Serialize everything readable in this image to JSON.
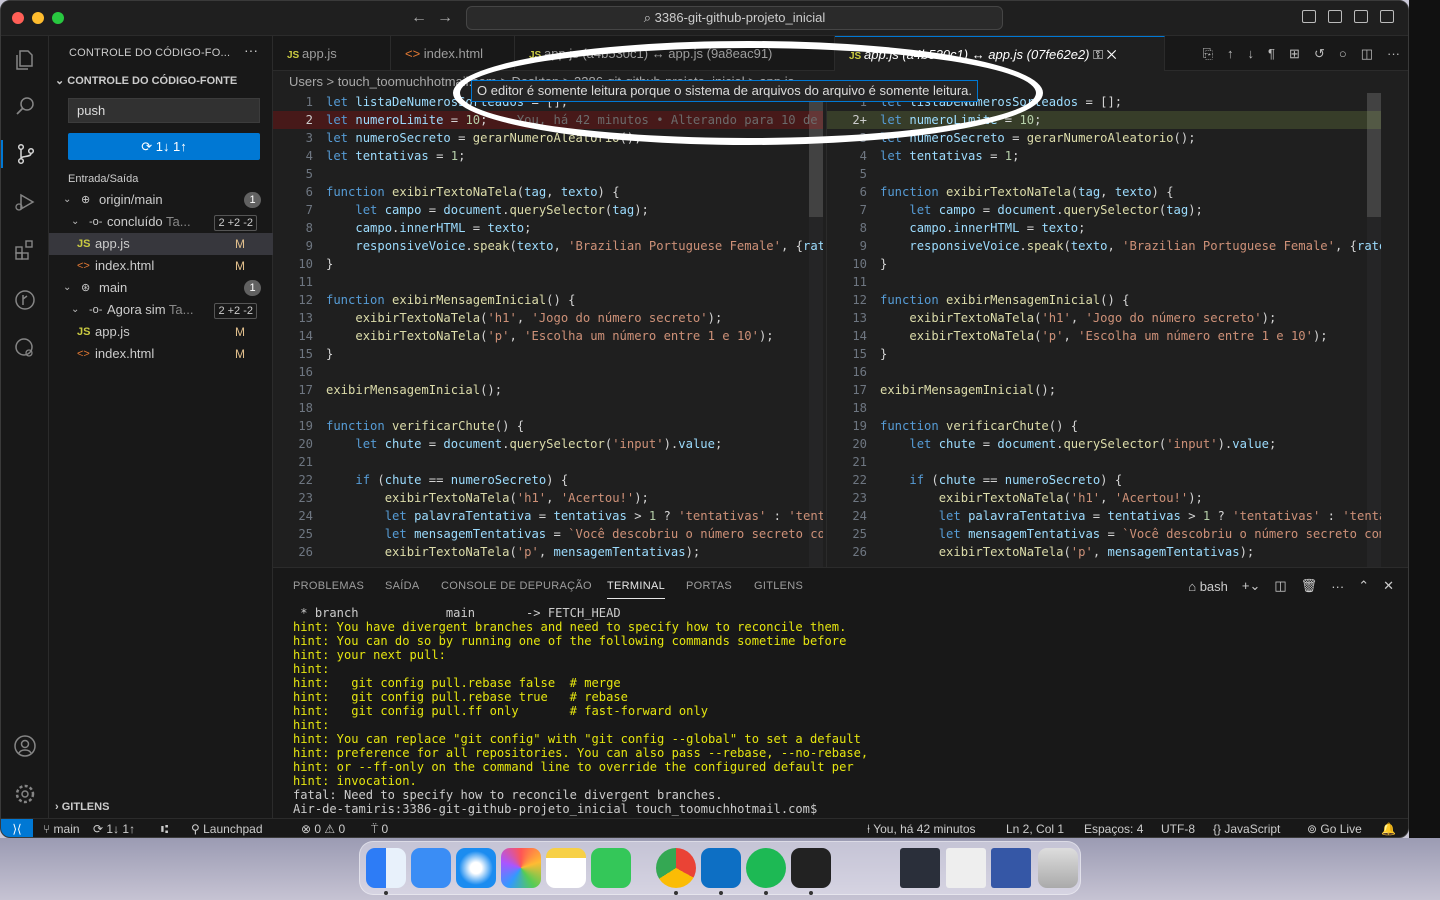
{
  "titlebar": {
    "search": "3386-git-github-projeto_inicial"
  },
  "sidebar": {
    "header": "CONTROLE DO CÓDIGO-FO...",
    "section": "CONTROLE DO CÓDIGO-FONTE",
    "commit_message": "push",
    "sync_button": "1↓ 1↑",
    "group_label": "Entrada/Saída",
    "tree": [
      {
        "label": "origin/main",
        "badge": "1"
      },
      {
        "label": "concluído",
        "suffix": "Ta...",
        "stat": "2 +2 -2"
      },
      {
        "label": "app.js",
        "status": "M"
      },
      {
        "label": "index.html",
        "status": "M"
      },
      {
        "label": "main",
        "badge": "1"
      },
      {
        "label": "Agora sim",
        "suffix": "Ta...",
        "stat": "2 +2 -2"
      },
      {
        "label": "app.js",
        "status": "M"
      },
      {
        "label": "index.html",
        "status": "M"
      }
    ],
    "gitlens": "GITLENS"
  },
  "tabs": [
    {
      "label": "app.js"
    },
    {
      "label": "index.html"
    },
    {
      "label": "app.js (a4b530c1) ↔ app.js (9a8eac91)"
    },
    {
      "label": "app.js (a4b530c1) ↔ app.js (07fe62e2)"
    }
  ],
  "breadcrumb": "Users > touch_toomuchhotmail.com > Desktop > 3386-git-github-projeto_inicial > app.js",
  "tooltip": "O editor é somente leitura porque o sistema de arquivos do arquivo é somente leitura.",
  "left_editor": {
    "lines": [
      {
        "n": "1",
        "text": "let listaDeNumerosSorteados = [];"
      },
      {
        "n": "2",
        "text": "let numeroLimite = 10;",
        "blame": "You, há 42 minutos • Alterando para 10 de"
      },
      {
        "n": "3",
        "text": "let numeroSecreto = gerarNumeroAleatorio();"
      },
      {
        "n": "4",
        "text": "let tentativas = 1;"
      },
      {
        "n": "5",
        "text": ""
      },
      {
        "n": "6",
        "text": "function exibirTextoNaTela(tag, texto) {"
      },
      {
        "n": "7",
        "text": "    let campo = document.querySelector(tag);"
      },
      {
        "n": "8",
        "text": "    campo.innerHTML = texto;"
      },
      {
        "n": "9",
        "text": "    responsiveVoice.speak(texto, 'Brazilian Portuguese Female', {rate"
      },
      {
        "n": "10",
        "text": "}"
      },
      {
        "n": "11",
        "text": ""
      },
      {
        "n": "12",
        "text": "function exibirMensagemInicial() {"
      },
      {
        "n": "13",
        "text": "    exibirTextoNaTela('h1', 'Jogo do número secreto');"
      },
      {
        "n": "14",
        "text": "    exibirTextoNaTela('p', 'Escolha um número entre 1 e 10');"
      },
      {
        "n": "15",
        "text": "}"
      },
      {
        "n": "16",
        "text": ""
      },
      {
        "n": "17",
        "text": "exibirMensagemInicial();"
      },
      {
        "n": "18",
        "text": ""
      },
      {
        "n": "19",
        "text": "function verificarChute() {"
      },
      {
        "n": "20",
        "text": "    let chute = document.querySelector('input').value;"
      },
      {
        "n": "21",
        "text": ""
      },
      {
        "n": "22",
        "text": "    if (chute == numeroSecreto) {"
      },
      {
        "n": "23",
        "text": "        exibirTextoNaTela('h1', 'Acertou!');"
      },
      {
        "n": "24",
        "text": "        let palavraTentativa = tentativas > 1 ? 'tentativas' : 'tenta"
      },
      {
        "n": "25",
        "text": "        let mensagemTentativas = `Você descobriu o número secreto com"
      },
      {
        "n": "26",
        "text": "        exibirTextoNaTela('p', mensagemTentativas);"
      }
    ]
  },
  "right_editor": {
    "lines": [
      {
        "n": "1",
        "text": "let listaDeNumerosSorteados = [];"
      },
      {
        "n": "2+",
        "text": "let numeroLimite = 10;"
      },
      {
        "n": "3",
        "text": "let numeroSecreto = gerarNumeroAleatorio();"
      },
      {
        "n": "4",
        "text": "let tentativas = 1;"
      },
      {
        "n": "5",
        "text": ""
      },
      {
        "n": "6",
        "text": "function exibirTextoNaTela(tag, texto) {"
      },
      {
        "n": "7",
        "text": "    let campo = document.querySelector(tag);"
      },
      {
        "n": "8",
        "text": "    campo.innerHTML = texto;"
      },
      {
        "n": "9",
        "text": "    responsiveVoice.speak(texto, 'Brazilian Portuguese Female', {rate:"
      },
      {
        "n": "10",
        "text": "}"
      },
      {
        "n": "11",
        "text": ""
      },
      {
        "n": "12",
        "text": "function exibirMensagemInicial() {"
      },
      {
        "n": "13",
        "text": "    exibirTextoNaTela('h1', 'Jogo do número secreto');"
      },
      {
        "n": "14",
        "text": "    exibirTextoNaTela('p', 'Escolha um número entre 1 e 10');"
      },
      {
        "n": "15",
        "text": "}"
      },
      {
        "n": "16",
        "text": ""
      },
      {
        "n": "17",
        "text": "exibirMensagemInicial();"
      },
      {
        "n": "18",
        "text": ""
      },
      {
        "n": "19",
        "text": "function verificarChute() {"
      },
      {
        "n": "20",
        "text": "    let chute = document.querySelector('input').value;"
      },
      {
        "n": "21",
        "text": ""
      },
      {
        "n": "22",
        "text": "    if (chute == numeroSecreto) {"
      },
      {
        "n": "23",
        "text": "        exibirTextoNaTela('h1', 'Acertou!');"
      },
      {
        "n": "24",
        "text": "        let palavraTentativa = tentativas > 1 ? 'tentativas' : 'tentat"
      },
      {
        "n": "25",
        "text": "        let mensagemTentativas = `Você descobriu o número secreto com"
      },
      {
        "n": "26",
        "text": "        exibirTextoNaTela('p', mensagemTentativas);"
      }
    ]
  },
  "panel": {
    "tabs": [
      "PROBLEMAS",
      "SAÍDA",
      "CONSOLE DE DEPURAÇÃO",
      "TERMINAL",
      "PORTAS",
      "GITLENS"
    ],
    "shell": "bash",
    "terminal": [
      {
        "text": " * branch            main       -> FETCH_HEAD",
        "hint": false
      },
      {
        "text": "hint: You have divergent branches and need to specify how to reconcile them.",
        "hint": true
      },
      {
        "text": "hint: You can do so by running one of the following commands sometime before",
        "hint": true
      },
      {
        "text": "hint: your next pull:",
        "hint": true
      },
      {
        "text": "hint:",
        "hint": true
      },
      {
        "text": "hint:   git config pull.rebase false  # merge",
        "hint": true
      },
      {
        "text": "hint:   git config pull.rebase true   # rebase",
        "hint": true
      },
      {
        "text": "hint:   git config pull.ff only       # fast-forward only",
        "hint": true
      },
      {
        "text": "hint:",
        "hint": true
      },
      {
        "text": "hint: You can replace \"git config\" with \"git config --global\" to set a default",
        "hint": true
      },
      {
        "text": "hint: preference for all repositories. You can also pass --rebase, --no-rebase,",
        "hint": true
      },
      {
        "text": "hint: or --ff-only on the command line to override the configured default per",
        "hint": true
      },
      {
        "text": "hint: invocation.",
        "hint": true
      },
      {
        "text": "fatal: Need to specify how to reconcile divergent branches.",
        "hint": false
      },
      {
        "text": "Air-de-tamiris:3386-git-github-projeto_inicial touch_toomuchhotmail.com$ ",
        "hint": false
      }
    ]
  },
  "statusbar": {
    "branch": "main",
    "sync": "1↓ 1↑",
    "launchpad": "Launchpad",
    "errors": "0",
    "warnings": "0",
    "ports": "0",
    "blame": "You, há 42 minutos",
    "cursor": "Ln 2, Col 1",
    "spaces": "Espaços: 4",
    "encoding": "UTF-8",
    "language": "JavaScript",
    "golive": "Go Live"
  }
}
